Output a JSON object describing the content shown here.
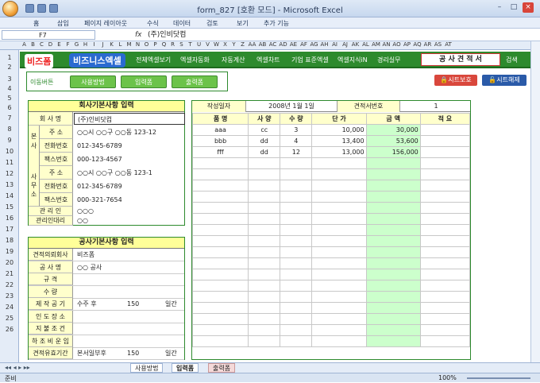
{
  "window": {
    "title": "form_827  [호환 모드] - Microsoft Excel",
    "controls": [
      "–",
      "□",
      "×"
    ]
  },
  "menu": [
    "홈",
    "삽입",
    "페이지 레이아웃",
    "수식",
    "데이터",
    "검토",
    "보기",
    "추가 기능"
  ],
  "formula_bar": {
    "cell": "F7",
    "fx": "fx",
    "content": "(주)인비닷컴"
  },
  "columns": [
    "A",
    "B",
    "C",
    "D",
    "E",
    "F",
    "G",
    "H",
    "I",
    "J",
    "K",
    "L",
    "M",
    "N",
    "O",
    "P",
    "Q",
    "R",
    "S",
    "T",
    "U",
    "V",
    "W",
    "X",
    "Y",
    "Z",
    "AA",
    "AB",
    "AC",
    "AD",
    "AE",
    "AF",
    "AG",
    "AH",
    "AI",
    "AJ",
    "AK",
    "AL",
    "AM",
    "AN",
    "AO",
    "AP",
    "AQ",
    "AR",
    "AS",
    "AT"
  ],
  "rows": [
    "1",
    "2",
    "3",
    "4",
    "5",
    "6",
    "7",
    "8",
    "9",
    "10",
    "11",
    "12",
    "13",
    "14",
    "15",
    "16",
    "17",
    "18",
    "19",
    "20",
    "21",
    "22",
    "23",
    "24",
    "25",
    "26"
  ],
  "nav": {
    "logo": "비즈폼",
    "logo2": "비즈니스엑셀",
    "items": [
      "전체엑셀보기",
      "엑셀자동화",
      "자동계산",
      "엑셀차트",
      "기업 표준엑셀",
      "엑셀지식iN",
      "경리실무"
    ],
    "quote": "공 사  견 적 서",
    "search": "검색"
  },
  "move": {
    "label": "이동버튼",
    "buttons": [
      "사용방법",
      "입력폼",
      "출력폼"
    ]
  },
  "sheet_buttons": {
    "protect": "시트보호",
    "unprotect": "시트해제"
  },
  "company": {
    "title": "회사기본사항 입력",
    "name_label": "회    사    명",
    "name": "(주)인비닷컴",
    "group_head": "본\n사",
    "group_branch": "사\n무\n소",
    "address_label": "주    소",
    "phone_label": "전화번호",
    "fax_label": "팩스번호",
    "hq_address": "○○시 ○○구 ○○동 123-12",
    "hq_phone": "012-345-6789",
    "hq_fax": "000-123-4567",
    "br_address": "○○시 ○○구 ○○동 123-1",
    "br_phone": "012-345-6789",
    "br_fax": "000-321-7654",
    "manager_label": "관  리  인",
    "manager": "○○○",
    "proxy_label": "관리인대리",
    "proxy": "○○"
  },
  "project": {
    "title": "공사기본사항 입력",
    "rows": [
      {
        "label": "견적의뢰회사",
        "value": "비즈폼",
        "extra": "",
        "unit": ""
      },
      {
        "label": "공    사    명",
        "value": "○○ 공사",
        "extra": "",
        "unit": ""
      },
      {
        "label": "규          격",
        "value": "",
        "extra": "",
        "unit": ""
      },
      {
        "label": "수          량",
        "value": "",
        "extra": "",
        "unit": ""
      },
      {
        "label": "제 작 공 기",
        "value": "수주 후",
        "extra": "150",
        "unit": "일간"
      },
      {
        "label": "인 도 장 소",
        "value": "",
        "extra": "",
        "unit": ""
      },
      {
        "label": "지 불 조 건",
        "value": "",
        "extra": "",
        "unit": ""
      },
      {
        "label": "하 조 비 운 임",
        "value": "",
        "extra": "",
        "unit": ""
      },
      {
        "label": "견적유효기간",
        "value": "본서일부후",
        "extra": "150",
        "unit": "일간"
      }
    ]
  },
  "estimate": {
    "date_label": "작성일자",
    "date": "2008년 1월 1일",
    "no_label": "견적서번호",
    "no": "1",
    "headers": [
      "품      명",
      "사  양",
      "수  량",
      "단      가",
      "금      액",
      "적  요"
    ],
    "items": [
      [
        "aaa",
        "cc",
        "3",
        "10,000",
        "30,000",
        ""
      ],
      [
        "bbb",
        "dd",
        "4",
        "13,400",
        "53,600",
        ""
      ],
      [
        "fff",
        "dd",
        "12",
        "13,000",
        "156,000",
        ""
      ]
    ]
  },
  "tabs": [
    "사용방법",
    "입력폼",
    "출력폼"
  ],
  "status": {
    "ready": "준비",
    "zoom": "100%"
  }
}
